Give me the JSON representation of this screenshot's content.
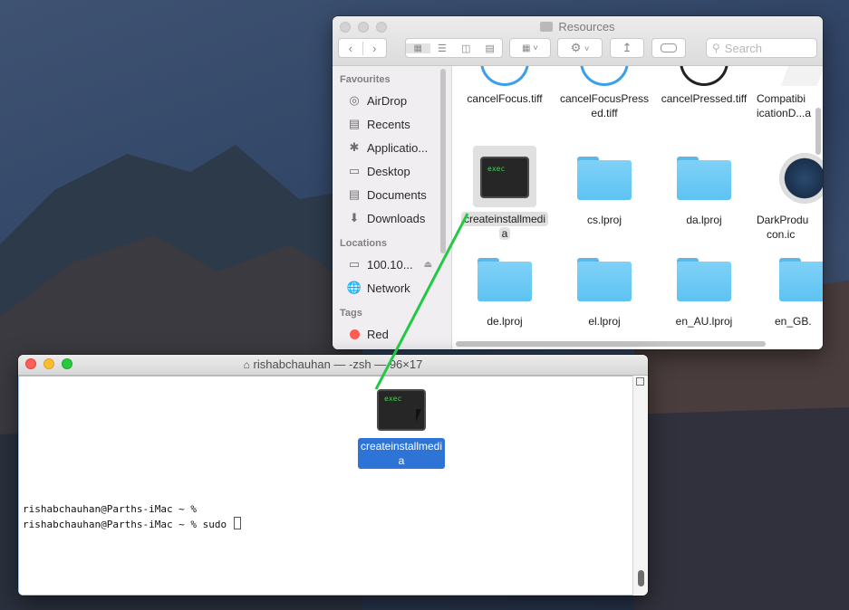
{
  "finder": {
    "title": "Resources",
    "search_placeholder": "Search",
    "sidebar": {
      "favourites_heading": "Favourites",
      "favourites": [
        {
          "label": "AirDrop",
          "icon": "airdrop-icon"
        },
        {
          "label": "Recents",
          "icon": "recents-icon"
        },
        {
          "label": "Applicatio...",
          "icon": "applications-icon"
        },
        {
          "label": "Desktop",
          "icon": "desktop-icon"
        },
        {
          "label": "Documents",
          "icon": "documents-icon"
        },
        {
          "label": "Downloads",
          "icon": "downloads-icon"
        }
      ],
      "locations_heading": "Locations",
      "locations": [
        {
          "label": "100.10...",
          "icon": "display-icon"
        },
        {
          "label": "Network",
          "icon": "network-icon"
        }
      ],
      "tags_heading": "Tags",
      "tags": [
        {
          "label": "Red",
          "color": "#ff5b53"
        }
      ]
    },
    "files": [
      {
        "name_line1": "cancelFocus.tiff",
        "name_line2": "",
        "kind": "partial-image"
      },
      {
        "name_line1": "cancelFocusPress",
        "name_line2": "ed.tiff",
        "kind": "partial-image"
      },
      {
        "name_line1": "cancelPressed.tiff",
        "name_line2": "",
        "kind": "partial-image"
      },
      {
        "name_line1": "Compatibi",
        "name_line2": "icationD...a",
        "kind": "partial-doc"
      },
      {
        "name_line1": "createinstallmedi",
        "name_line2": "a",
        "kind": "exec",
        "icon_text": "exec",
        "selected": true
      },
      {
        "name_line1": "cs.lproj",
        "name_line2": "",
        "kind": "folder"
      },
      {
        "name_line1": "da.lproj",
        "name_line2": "",
        "kind": "folder"
      },
      {
        "name_line1": "DarkProdu",
        "name_line2": "con.ic",
        "kind": "icns"
      },
      {
        "name_line1": "de.lproj",
        "name_line2": "",
        "kind": "folder"
      },
      {
        "name_line1": "el.lproj",
        "name_line2": "",
        "kind": "folder"
      },
      {
        "name_line1": "en_AU.lproj",
        "name_line2": "",
        "kind": "folder"
      },
      {
        "name_line1": "en_GB.",
        "name_line2": "",
        "kind": "folder"
      }
    ]
  },
  "terminal": {
    "title": "rishabchauhan — -zsh — 96×17",
    "lines": [
      "rishabchauhan@Parths-iMac ~ %",
      "rishabchauhan@Parths-iMac ~ % sudo "
    ]
  },
  "drag": {
    "icon_text": "exec",
    "label_line1": "createinstallmedi",
    "label_line2": "a"
  },
  "colors": {
    "accent": "#2e73d6",
    "drag_line": "#22c945",
    "folder": "#6cc9f5"
  }
}
